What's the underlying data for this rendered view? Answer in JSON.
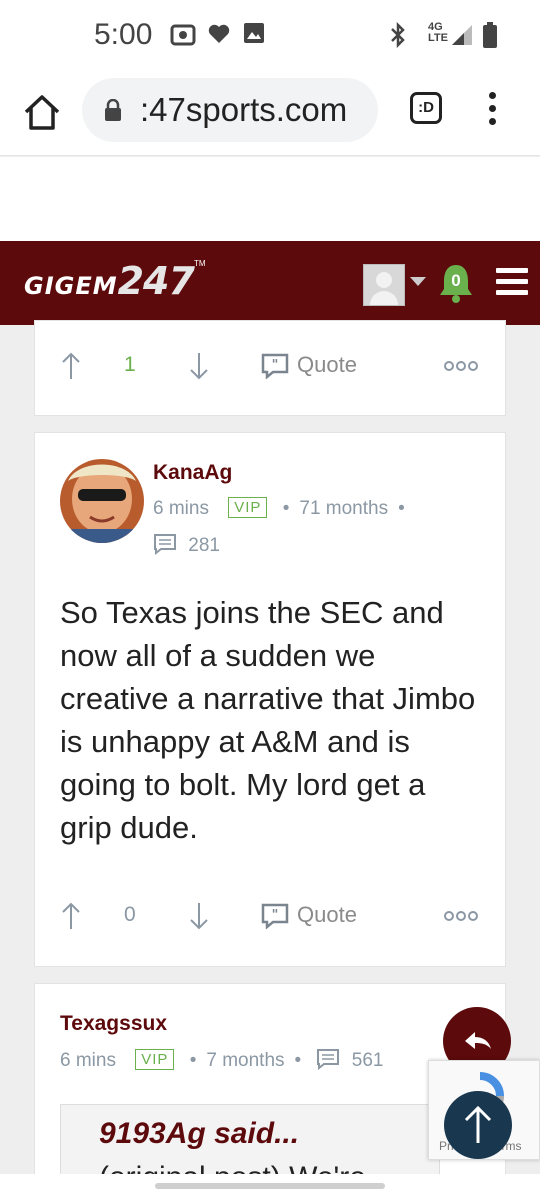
{
  "status_bar": {
    "time": "5:00",
    "network_top": "4G",
    "network_bottom": "LTE",
    "icons": [
      "radio-icon",
      "heart-icon",
      "image-icon",
      "bluetooth-icon",
      "signal-icon",
      "battery-icon"
    ]
  },
  "browser": {
    "url": ":47sports.com",
    "tab_label": ":D",
    "icons": [
      "home-icon",
      "lock-icon",
      "menu-dots-icon"
    ]
  },
  "site_header": {
    "logo_part1": "GIGEM",
    "logo_part2": "247",
    "logo_tm": "TM",
    "notification_count": "0",
    "background_color": "#5d0a0c",
    "icons": [
      "user-avatar-icon",
      "bell-icon",
      "hamburger-icon"
    ]
  },
  "posts": [
    {
      "upvotes": "1",
      "upvote_color": "#6ab04c",
      "quote_label": "Quote"
    },
    {
      "author": "KanaAg",
      "time": "6 mins",
      "badge": "VIP",
      "membership": "71 months",
      "post_count": "281",
      "body": "So Texas joins the SEC and now all of a sudden we creative a narrative that Jimbo is unhappy at A&M and is going to bolt. My lord get a grip dude.",
      "upvotes": "0",
      "quote_label": "Quote"
    },
    {
      "author": "Texagssux",
      "time": "6 mins",
      "badge": "VIP",
      "membership": "7 months",
      "post_count": "561",
      "quoted_author": "9193Ag said...",
      "quoted_peek": "(original post) We're"
    }
  ],
  "recaptcha": {
    "footer_text": "Privacy - Terms"
  }
}
